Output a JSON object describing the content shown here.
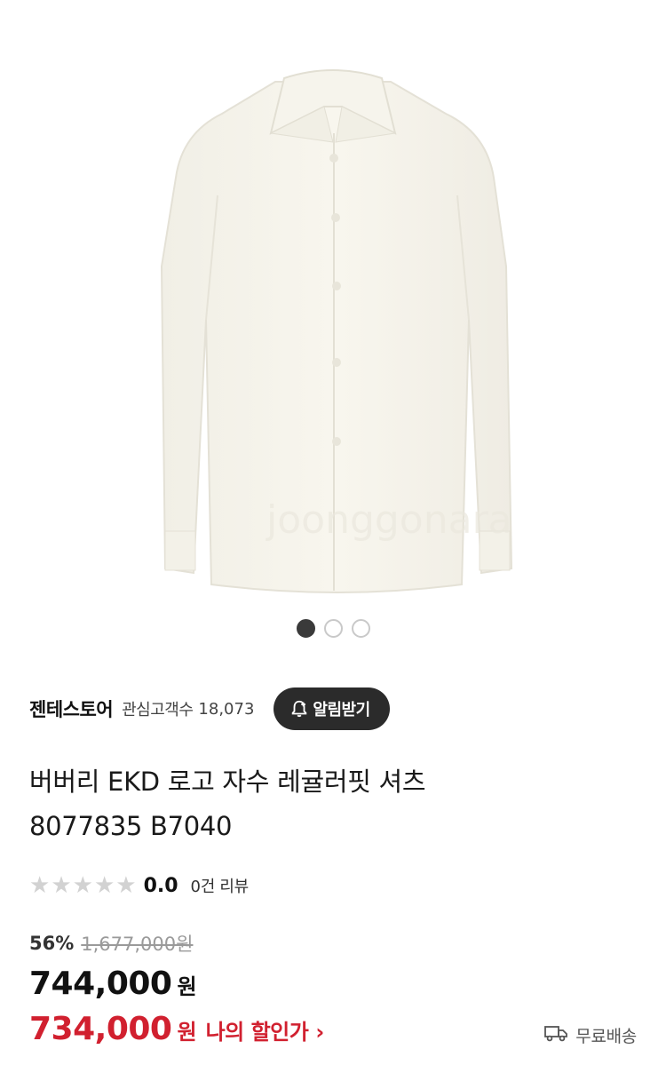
{
  "gallery": {
    "image_alt": "shirt-product-photo",
    "watermark": "joonggonara",
    "dots_total": 3,
    "active_index": 0
  },
  "seller": {
    "name": "젠테스토어",
    "follower_label": "관심고객수",
    "follower_count": "18,073",
    "notify_label": "알림받기"
  },
  "product": {
    "title_line1": "버버리 EKD 로고 자수 레귤러핏 셔츠",
    "title_line2": "8077835 B7040"
  },
  "rating": {
    "score": "0.0",
    "stars_filled": 0,
    "stars_total": 5,
    "review_text": "0건 리뷰"
  },
  "price": {
    "discount_rate": "56%",
    "original": "1,677,000원",
    "sale": "744,000",
    "sale_unit": "원",
    "my_price": "734,000",
    "my_unit": "원",
    "my_discount_label": "나의 할인가",
    "chevron": "›"
  },
  "shipping": {
    "label": "무료배송",
    "icon": "truck-icon"
  },
  "colors": {
    "accent_red": "#d1202f",
    "dark_button": "#2b2b2b",
    "star_empty": "#d2d2d2"
  }
}
